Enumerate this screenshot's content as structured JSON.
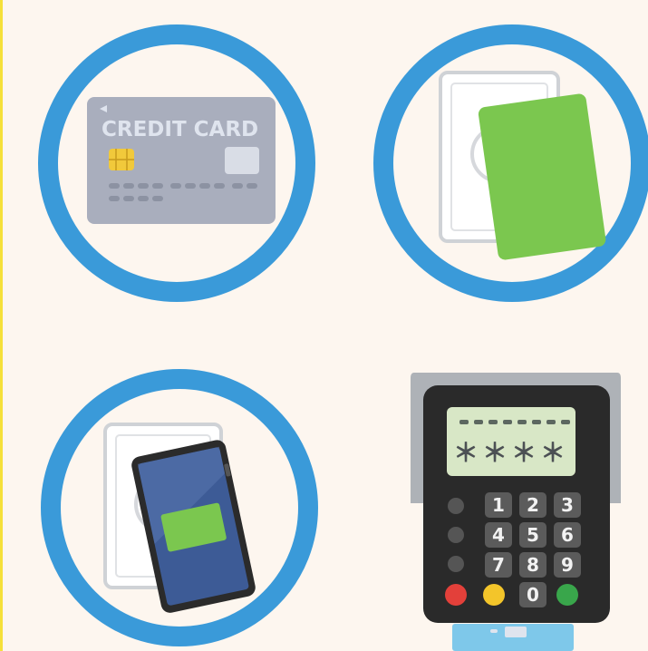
{
  "credit_card": {
    "label": "CREDIT CARD"
  },
  "pin_pad": {
    "masked_pin": "＊＊＊＊",
    "keys": [
      "1",
      "2",
      "3",
      "4",
      "5",
      "6",
      "7",
      "8",
      "9",
      "0"
    ]
  },
  "colors": {
    "ring": "#3a9ad9",
    "card_gray": "#a9aebd",
    "contactless_card": "#7bc74f",
    "phone_screen": "#3d5b96",
    "terminal_body": "#2a2a2a",
    "button_red": "#e3403a",
    "button_yellow": "#f3c52a",
    "button_green": "#39a64b"
  },
  "icons": [
    "credit-card-icon",
    "contactless-card-icon",
    "smartphone-payment-icon",
    "card-terminal-icon"
  ]
}
